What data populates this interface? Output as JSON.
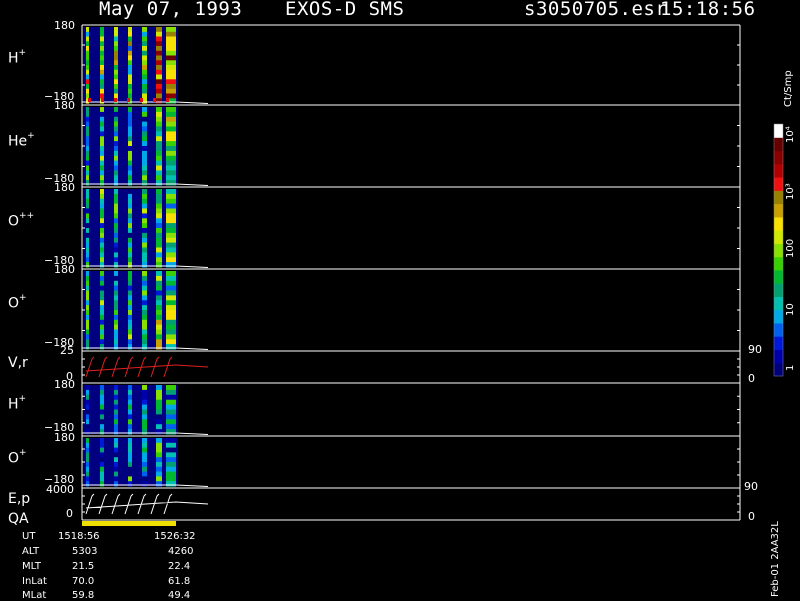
{
  "header": {
    "date": "May 07, 1993",
    "instrument": "EXOS-D SMS",
    "file": "s3050705.esr",
    "time": "15:18:56"
  },
  "panels": [
    {
      "id": "hp1",
      "label": "H",
      "sup": "+",
      "ytop": "180",
      "ybot": "−180"
    },
    {
      "id": "hep",
      "label": "He",
      "sup": "+",
      "ytop": "180",
      "ybot": "−180"
    },
    {
      "id": "opp",
      "label": "O",
      "sup": "++",
      "ytop": "180",
      "ybot": "−180"
    },
    {
      "id": "op1",
      "label": "O",
      "sup": "+",
      "ytop": "180",
      "ybot": "−180"
    },
    {
      "id": "vr",
      "label": "V,r",
      "sup": "",
      "ytop": "25",
      "ybot": "0",
      "rtop": "90",
      "rbot": "0"
    },
    {
      "id": "hp2",
      "label": "H",
      "sup": "+",
      "ytop": "180",
      "ybot": "−180"
    },
    {
      "id": "op2",
      "label": "O",
      "sup": "+",
      "ytop": "180",
      "ybot": "−180"
    },
    {
      "id": "ep",
      "label": "E,p",
      "sup": "",
      "ytop": "4000",
      "ybot": "0",
      "rtop": "90",
      "rbot": "0"
    }
  ],
  "qa_label": "QA",
  "colorbar": {
    "unit": "Ct/Smp",
    "ticks": [
      "1",
      "10",
      "100",
      "10³",
      "10⁴"
    ],
    "colors": [
      "#00007a",
      "#0000a8",
      "#0018d8",
      "#0060f0",
      "#00a8e8",
      "#00c0b0",
      "#00a070",
      "#00b830",
      "#38d000",
      "#88e000",
      "#d0e800",
      "#f8e000",
      "#c8a000",
      "#988000",
      "#f01010",
      "#b00000",
      "#880000",
      "#640000",
      "#ffffff"
    ]
  },
  "orbit_table": {
    "rows": [
      {
        "name": "UT",
        "v1": "1518:56",
        "v2": "1526:32"
      },
      {
        "name": "ALT",
        "v1": "5303",
        "v2": "4260"
      },
      {
        "name": "MLT",
        "v1": "21.5",
        "v2": "22.4"
      },
      {
        "name": "InLat",
        "v1": "70.0",
        "v2": "61.8"
      },
      {
        "name": "MLat",
        "v1": "59.8",
        "v2": "49.4"
      }
    ]
  },
  "footer_code": "Feb-01  2AA32L",
  "chart_data": {
    "type": "heatmap",
    "title": "May 07, 1993   EXOS-D SMS",
    "x": [
      "1518:56",
      "1526:32"
    ],
    "ylim": [
      -180,
      180
    ],
    "zunit": "Ct/Smp",
    "zscale": "log",
    "zlim": [
      1,
      10000
    ],
    "series": [
      {
        "name": "H⁺",
        "values": []
      },
      {
        "name": "He⁺",
        "values": []
      },
      {
        "name": "O⁺⁺",
        "values": []
      },
      {
        "name": "O⁺",
        "values": []
      },
      {
        "name": "V,r",
        "values": []
      },
      {
        "name": "H⁺",
        "values": []
      },
      {
        "name": "O⁺",
        "values": []
      },
      {
        "name": "E,p",
        "values": []
      }
    ]
  }
}
